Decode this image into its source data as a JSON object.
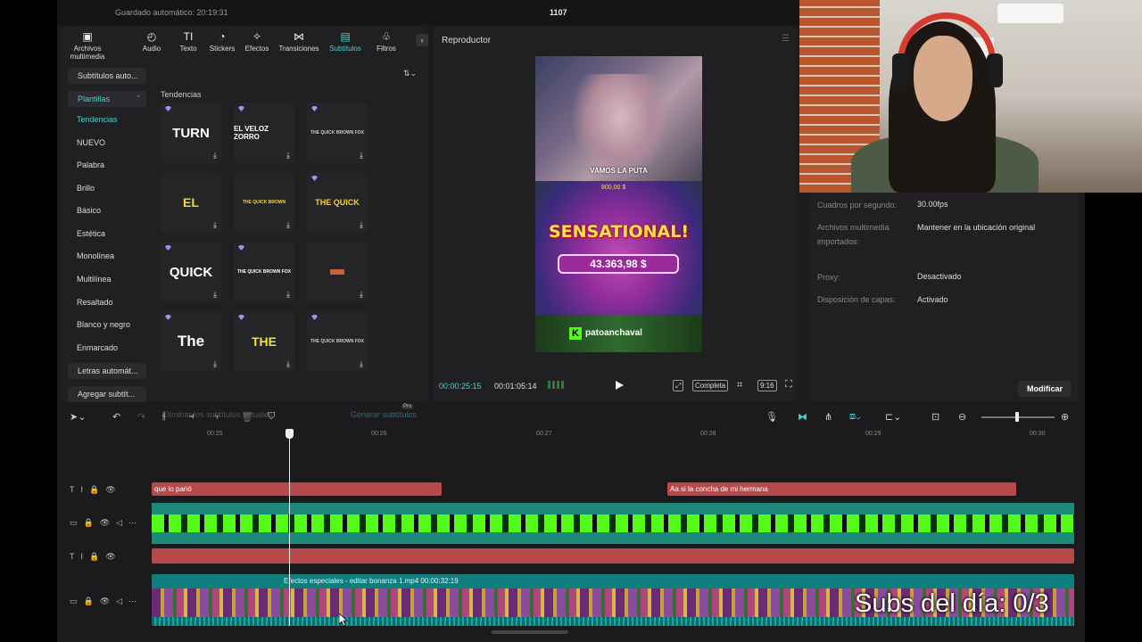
{
  "topbar": {
    "autosave": "Guardado automático: 20:19:31",
    "project_title": "1107"
  },
  "media_tabs": [
    {
      "label": "Archivos multimedia",
      "icon": "media-icon"
    },
    {
      "label": "Audio",
      "icon": "audio-icon"
    },
    {
      "label": "Texto",
      "icon": "text-icon"
    },
    {
      "label": "Stickers",
      "icon": "sticker-icon"
    },
    {
      "label": "Efectos",
      "icon": "effects-icon"
    },
    {
      "label": "Transiciones",
      "icon": "transitions-icon"
    },
    {
      "label": "Subtítulos",
      "icon": "subtitles-icon",
      "active": true
    },
    {
      "label": "Filtros",
      "icon": "filters-icon"
    }
  ],
  "sidebar": {
    "auto_subtitles": "Subtítulos auto...",
    "templates": "Plantillas",
    "items": [
      "Tendencias",
      "NUEVO",
      "Palabra",
      "Brillo",
      "Básico",
      "Estética",
      "Monolínea",
      "Multilínea",
      "Resaltado",
      "Blanco y negro",
      "Enmarcado"
    ],
    "auto_lyrics": "Letras automát...",
    "add_subtitles": "Agregar subtít..."
  },
  "section_title": "Tendencias",
  "template_cards": [
    {
      "text": "TURN",
      "color": "#ffffff"
    },
    {
      "text": "EL VELOZ ZORRO",
      "color": "#ffffff"
    },
    {
      "text": "THE QUICK BROWN FOX",
      "color": "#cccccc"
    },
    {
      "text": "EL",
      "color": "#f5d23a"
    },
    {
      "text": "THE QUICK BROWN",
      "color": "#f5d23a"
    },
    {
      "text": "THE QUICK",
      "color": "#f5d23a"
    },
    {
      "text": "QUICK",
      "color": "#ffffff"
    },
    {
      "text": "THE QUICK BROWN FOX",
      "color": "#ffffff"
    },
    {
      "text": "",
      "color": "#e0a040"
    },
    {
      "text": "The",
      "color": "#ffffff"
    },
    {
      "text": "THE",
      "color": "#f5e23a"
    },
    {
      "text": "THE QUICK BROWN FOX",
      "color": "#cccccc"
    }
  ],
  "subtitle_actions": {
    "remove": "Eliminar los subtítulos actuales",
    "generate": "Generar subtítulos",
    "pro": "Pro"
  },
  "player": {
    "title": "Reproductor",
    "caption": "VAMOS LA PUTA",
    "game_title": "SENSATIONAL!",
    "win_amount": "43.363,98 $",
    "bet_small": "800,00 $",
    "streamer": "patoanchaval",
    "time_current": "00:00:25:15",
    "time_total": "00:01:05:14",
    "quality": "Completa",
    "ratio": "9:16"
  },
  "properties": [
    {
      "label": "Cuadros por segundo:",
      "value": "30.00fps"
    },
    {
      "label": "Archivos multimedia importados:",
      "value": "Mantener en la ubicación original"
    },
    {
      "label": "Proxy:",
      "value": "Desactivado"
    },
    {
      "label": "Disposición de capas:",
      "value": "Activado"
    }
  ],
  "modify_button": "Modificar",
  "ruler_ticks": [
    "00:25",
    "00:26",
    "00:27",
    "00:28",
    "00:29",
    "00:30"
  ],
  "timeline": {
    "clip_1": "que lo parió",
    "clip_2": "Aa si la concha de mi hermana",
    "video_clip_label": "Efectos especiales - editar   bonanza 1.mp4   00:00:32:19"
  },
  "overlay_counter": "Subs del día: 0/3",
  "colors": {
    "accent": "#4cd0d0",
    "clip_red": "#b8494a",
    "track_teal": "#0f7e7e",
    "kick_green": "#53fc18"
  }
}
